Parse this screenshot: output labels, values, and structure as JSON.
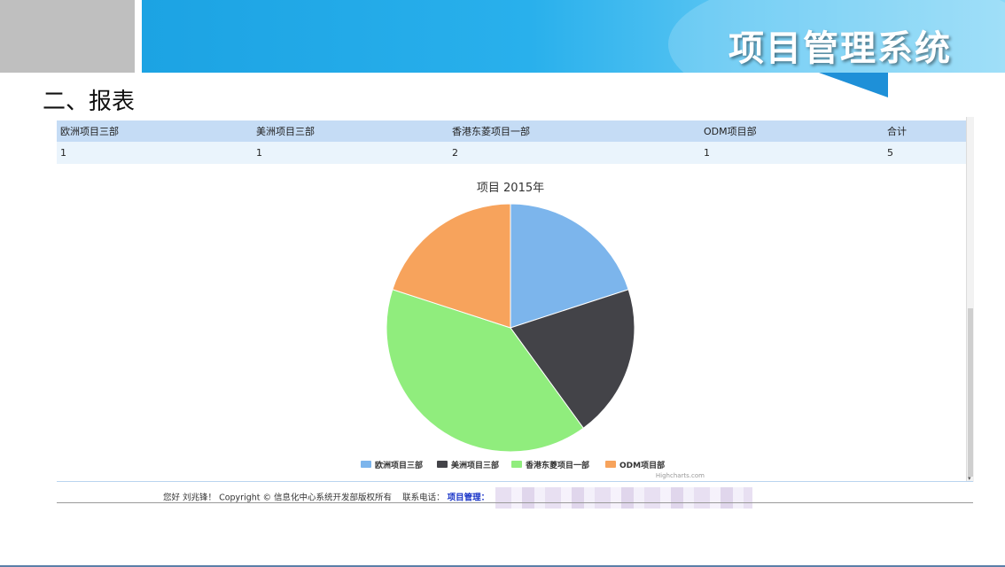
{
  "header": {
    "app_title": "项目管理系统"
  },
  "section": {
    "heading": "二、报表"
  },
  "table": {
    "columns": [
      "欧洲项目三部",
      "美洲项目三部",
      "香港东菱项目一部",
      "ODM项目部",
      "合计"
    ],
    "rows": [
      [
        "1",
        "1",
        "2",
        "1",
        "5"
      ]
    ]
  },
  "chart_data": {
    "type": "pie",
    "title": "项目 2015年",
    "categories": [
      "欧洲项目三部",
      "美洲项目三部",
      "香港东菱项目一部",
      "ODM项目部"
    ],
    "values": [
      1,
      1,
      2,
      1
    ],
    "colors": [
      "#7cb5ec",
      "#434348",
      "#90ed7d",
      "#f7a35c"
    ],
    "legend_position": "bottom-center",
    "credits": "Highcharts.com"
  },
  "footer": {
    "greeting": "您好 刘兆锋！",
    "copyright": "Copyright © 信息化中心系统开发部版权所有",
    "contact_label": "联系电话：",
    "project_mgmt_label": "项目管理："
  }
}
